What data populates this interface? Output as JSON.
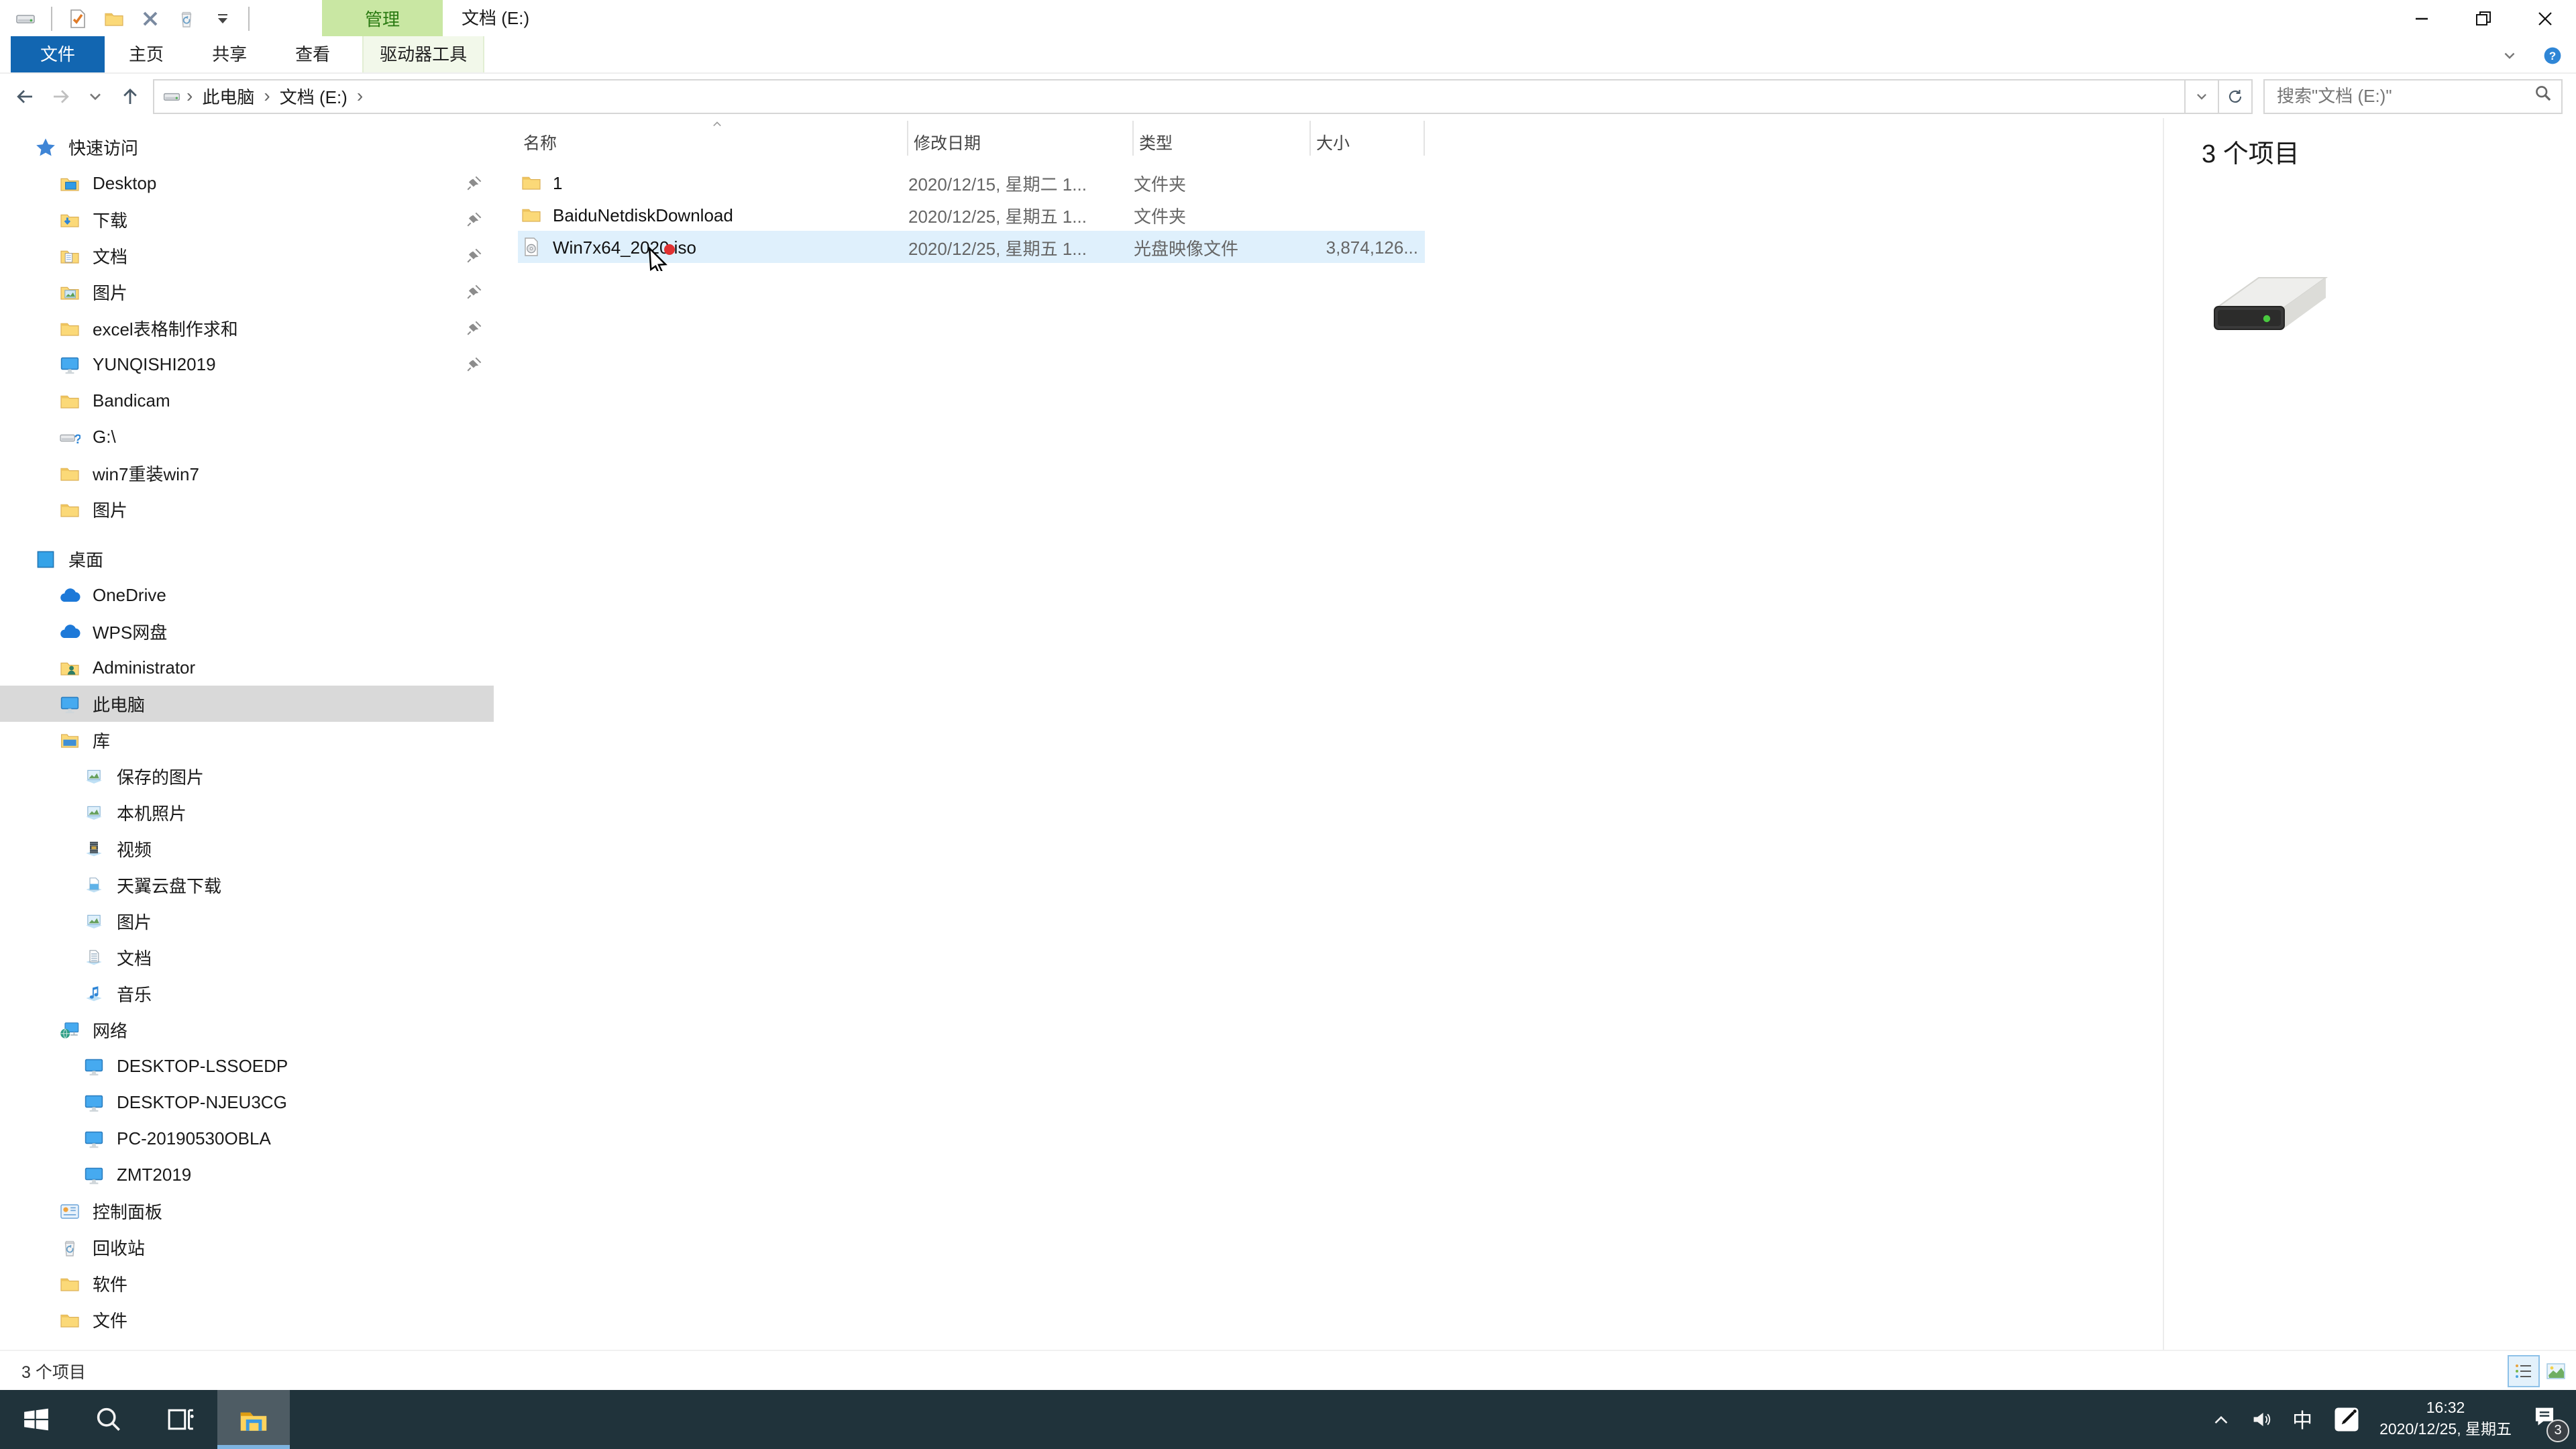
{
  "window": {
    "title": "文档 (E:)",
    "contextual_tab_header": "管理",
    "qat_icons": [
      "drive-icon",
      "sep",
      "checked-document-icon",
      "folder-icon",
      "close-icon",
      "recycle-bin-icon",
      "dropdown-icon",
      "sep"
    ],
    "controls": [
      "minimize-icon",
      "restore-icon",
      "close-icon"
    ]
  },
  "ribbon": {
    "tabs": [
      {
        "label": "文件",
        "style": "file"
      },
      {
        "label": "主页",
        "style": "normal"
      },
      {
        "label": "共享",
        "style": "normal"
      },
      {
        "label": "查看",
        "style": "normal"
      },
      {
        "label": "驱动器工具",
        "style": "ctx"
      }
    ],
    "right_icons": [
      "chevron-down-icon",
      "help-icon"
    ]
  },
  "nav": {
    "buttons": [
      "back-icon",
      "forward-icon",
      "chevron-down-icon",
      "up-icon"
    ],
    "breadcrumb_icon": "drive-icon",
    "breadcrumb": [
      "此电脑",
      "文档 (E:)"
    ],
    "bar_cells": [
      "chevron-down-icon",
      "refresh-icon"
    ],
    "search_placeholder": "搜索\"文档 (E:)\"",
    "search_icon": "magnifier-icon"
  },
  "list": {
    "columns": [
      "名称",
      "修改日期",
      "类型",
      "大小"
    ],
    "sort_column": "名称",
    "files": [
      {
        "name": "1",
        "icon": "folder-icon",
        "date": "2020/12/15, 星期二 1...",
        "type": "文件夹",
        "size": "",
        "selected": false
      },
      {
        "name": "BaiduNetdiskDownload",
        "icon": "folder-icon",
        "date": "2020/12/25, 星期五 1...",
        "type": "文件夹",
        "size": "",
        "selected": false
      },
      {
        "name": "Win7x64_2020.iso",
        "icon": "disc-image-icon",
        "date": "2020/12/25, 星期五 1...",
        "type": "光盘映像文件",
        "size": "3,874,126...",
        "selected": true
      }
    ]
  },
  "sidebar": {
    "items": [
      {
        "label": "快速访问",
        "icon": "star-icon",
        "level": 0,
        "pinned": false,
        "selected": false,
        "gap": false
      },
      {
        "label": "Desktop",
        "icon": "folder-desktop-icon",
        "level": 1,
        "pinned": true,
        "selected": false,
        "gap": false
      },
      {
        "label": "下载",
        "icon": "folder-download-icon",
        "level": 1,
        "pinned": true,
        "selected": false,
        "gap": false
      },
      {
        "label": "文档",
        "icon": "folder-documents-icon",
        "level": 1,
        "pinned": true,
        "selected": false,
        "gap": false
      },
      {
        "label": "图片",
        "icon": "folder-pictures-icon",
        "level": 1,
        "pinned": true,
        "selected": false,
        "gap": false
      },
      {
        "label": "excel表格制作求和",
        "icon": "folder-icon",
        "level": 1,
        "pinned": true,
        "selected": false,
        "gap": false
      },
      {
        "label": "YUNQISHI2019",
        "icon": "computer-icon",
        "level": 1,
        "pinned": true,
        "selected": false,
        "gap": false
      },
      {
        "label": "Bandicam",
        "icon": "folder-icon",
        "level": 1,
        "pinned": false,
        "selected": false,
        "gap": false
      },
      {
        "label": "G:\\",
        "icon": "drive-unknown-icon",
        "level": 1,
        "pinned": false,
        "selected": false,
        "gap": false
      },
      {
        "label": "win7重装win7",
        "icon": "folder-icon",
        "level": 1,
        "pinned": false,
        "selected": false,
        "gap": false
      },
      {
        "label": "图片",
        "icon": "folder-icon",
        "level": 1,
        "pinned": false,
        "selected": false,
        "gap": false
      },
      {
        "label": "桌面",
        "icon": "desktop-icon",
        "level": 0,
        "pinned": false,
        "selected": false,
        "gap": true
      },
      {
        "label": "OneDrive",
        "icon": "cloud-icon",
        "level": 1,
        "pinned": false,
        "selected": false,
        "gap": false
      },
      {
        "label": "WPS网盘",
        "icon": "cloud-icon",
        "level": 1,
        "pinned": false,
        "selected": false,
        "gap": false
      },
      {
        "label": "Administrator",
        "icon": "user-folder-icon",
        "level": 1,
        "pinned": false,
        "selected": false,
        "gap": false
      },
      {
        "label": "此电脑",
        "icon": "computer-icon",
        "level": 1,
        "pinned": false,
        "selected": true,
        "gap": false
      },
      {
        "label": "库",
        "icon": "library-icon",
        "level": 1,
        "pinned": false,
        "selected": false,
        "gap": false
      },
      {
        "label": "保存的图片",
        "icon": "library-pictures-icon",
        "level": 2,
        "pinned": false,
        "selected": false,
        "gap": false
      },
      {
        "label": "本机照片",
        "icon": "library-pictures-icon",
        "level": 2,
        "pinned": false,
        "selected": false,
        "gap": false
      },
      {
        "label": "视频",
        "icon": "library-videos-icon",
        "level": 2,
        "pinned": false,
        "selected": false,
        "gap": false
      },
      {
        "label": "天翼云盘下载",
        "icon": "library-downloads-icon",
        "level": 2,
        "pinned": false,
        "selected": false,
        "gap": false
      },
      {
        "label": "图片",
        "icon": "library-pictures-icon",
        "level": 2,
        "pinned": false,
        "selected": false,
        "gap": false
      },
      {
        "label": "文档",
        "icon": "library-documents-icon",
        "level": 2,
        "pinned": false,
        "selected": false,
        "gap": false
      },
      {
        "label": "音乐",
        "icon": "library-music-icon",
        "level": 2,
        "pinned": false,
        "selected": false,
        "gap": false
      },
      {
        "label": "网络",
        "icon": "network-icon",
        "level": 1,
        "pinned": false,
        "selected": false,
        "gap": false
      },
      {
        "label": "DESKTOP-LSSOEDP",
        "icon": "computer-icon",
        "level": 2,
        "pinned": false,
        "selected": false,
        "gap": false
      },
      {
        "label": "DESKTOP-NJEU3CG",
        "icon": "computer-icon",
        "level": 2,
        "pinned": false,
        "selected": false,
        "gap": false
      },
      {
        "label": "PC-20190530OBLA",
        "icon": "computer-icon",
        "level": 2,
        "pinned": false,
        "selected": false,
        "gap": false
      },
      {
        "label": "ZMT2019",
        "icon": "computer-icon",
        "level": 2,
        "pinned": false,
        "selected": false,
        "gap": false
      },
      {
        "label": "控制面板",
        "icon": "control-panel-icon",
        "level": 1,
        "pinned": false,
        "selected": false,
        "gap": false
      },
      {
        "label": "回收站",
        "icon": "recycle-bin-icon",
        "level": 1,
        "pinned": false,
        "selected": false,
        "gap": false
      },
      {
        "label": "软件",
        "icon": "folder-icon",
        "level": 1,
        "pinned": false,
        "selected": false,
        "gap": false
      },
      {
        "label": "文件",
        "icon": "folder-icon",
        "level": 1,
        "pinned": false,
        "selected": false,
        "gap": false
      }
    ]
  },
  "details_panel": {
    "count_text": "3 个项目",
    "icon": "hard-drive-icon"
  },
  "status_bar": {
    "count_text": "3 个项目",
    "view_buttons": [
      {
        "icon": "details-view-icon",
        "active": true
      },
      {
        "icon": "thumbnail-view-icon",
        "active": false
      }
    ]
  },
  "taskbar": {
    "buttons": [
      {
        "icon": "start-icon",
        "active": false
      },
      {
        "icon": "search-icon",
        "active": false
      },
      {
        "icon": "task-view-icon",
        "active": false
      },
      {
        "icon": "file-explorer-icon",
        "active": true
      }
    ],
    "tray_icons": [
      "chevron-up-icon",
      "speaker-icon"
    ],
    "ime_label": "中",
    "ime_mode_icon": "ime-pen-icon",
    "clock_time": "16:32",
    "clock_date": "2020/12/25, 星期五",
    "notification_icon": "notification-icon",
    "notification_badge": "3"
  },
  "colors": {
    "accent_blue": "#1266b1",
    "contextual_green_bg": "#c9e7a3",
    "contextual_green_text": "#2a7a12",
    "selection_blue": "#dff0fc",
    "sidebar_selected": "#d9d9d9",
    "taskbar_bg": "#20333b",
    "taskbar_active_underline": "#7fb4e0"
  }
}
